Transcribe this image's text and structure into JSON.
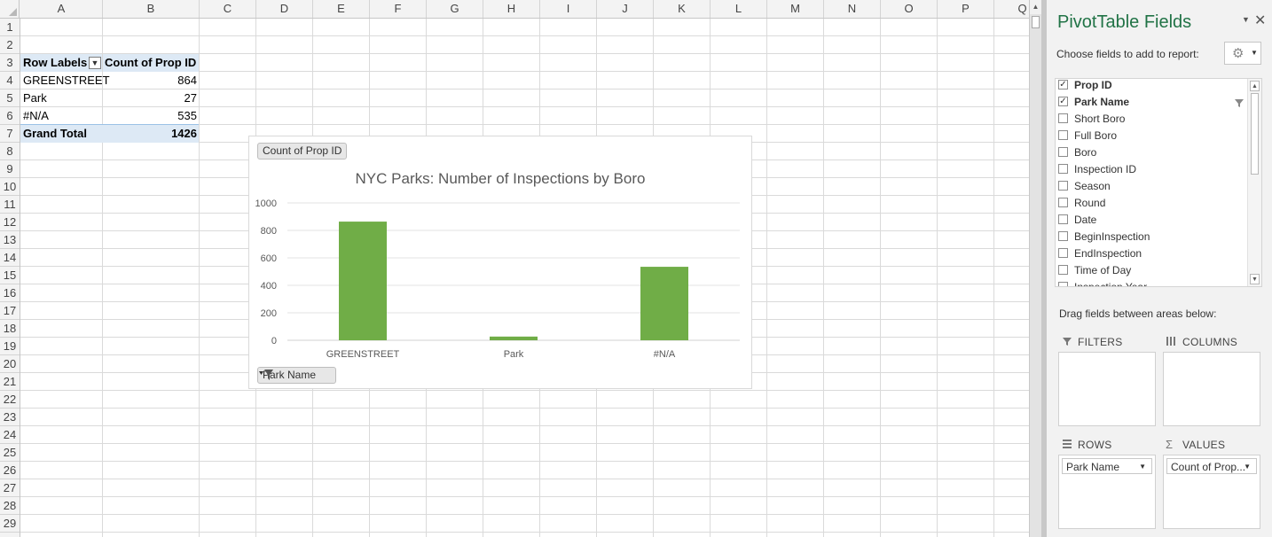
{
  "sheet": {
    "columns": [
      "A",
      "B",
      "C",
      "D",
      "E",
      "F",
      "G",
      "H",
      "I",
      "J",
      "K",
      "L",
      "M",
      "N",
      "O",
      "P",
      "Q"
    ],
    "rows": [
      "1",
      "2",
      "3",
      "4",
      "5",
      "6",
      "7",
      "8",
      "9",
      "10",
      "11",
      "12",
      "13",
      "14",
      "15",
      "16",
      "17",
      "18",
      "19",
      "20",
      "21",
      "22",
      "23",
      "24",
      "25",
      "26",
      "27",
      "28",
      "29"
    ]
  },
  "pivot_table": {
    "row_labels_header": "Row Labels",
    "value_header": "Count of Prop ID",
    "rows": [
      {
        "label": "GREENSTREET",
        "value": "864"
      },
      {
        "label": "Park",
        "value": "27"
      },
      {
        "label": "#N/A",
        "value": "535"
      }
    ],
    "total_label": "Grand Total",
    "total_value": "1426"
  },
  "chart": {
    "value_field_button": "Count of Prop ID",
    "axis_field_button": "Park Name",
    "title": "NYC Parks: Number of Inspections by Boro",
    "bar_color": "#70ad47"
  },
  "chart_data": {
    "type": "bar",
    "title": "NYC Parks: Number of Inspections by Boro",
    "categories": [
      "GREENSTREET",
      "Park",
      "#N/A"
    ],
    "values": [
      864,
      27,
      535
    ],
    "xlabel": "",
    "ylabel": "",
    "ylim": [
      0,
      1000
    ],
    "yticks": [
      "0",
      "200",
      "400",
      "600",
      "800",
      "1000"
    ],
    "grid": true,
    "legend": "none"
  },
  "pane": {
    "title": "PivotTable Fields",
    "choose_label": "Choose fields to add to report:",
    "fields": [
      {
        "label": "Prop ID",
        "checked": true,
        "filtered": false
      },
      {
        "label": "Park Name",
        "checked": true,
        "filtered": true
      },
      {
        "label": "Short Boro",
        "checked": false,
        "filtered": false
      },
      {
        "label": "Full Boro",
        "checked": false,
        "filtered": false
      },
      {
        "label": "Boro",
        "checked": false,
        "filtered": false
      },
      {
        "label": "Inspection ID",
        "checked": false,
        "filtered": false
      },
      {
        "label": "Season",
        "checked": false,
        "filtered": false
      },
      {
        "label": "Round",
        "checked": false,
        "filtered": false
      },
      {
        "label": "Date",
        "checked": false,
        "filtered": false
      },
      {
        "label": "BeginInspection",
        "checked": false,
        "filtered": false
      },
      {
        "label": "EndInspection",
        "checked": false,
        "filtered": false
      },
      {
        "label": "Time of Day",
        "checked": false,
        "filtered": false
      },
      {
        "label": "Inspection Year",
        "checked": false,
        "filtered": false
      }
    ],
    "drag_label": "Drag fields between areas below:",
    "areas": {
      "filters": "FILTERS",
      "columns": "COLUMNS",
      "rows": "ROWS",
      "values": "VALUES",
      "rows_item": "Park Name",
      "values_item": "Count of Prop..."
    }
  },
  "icons": {
    "close": "close-icon",
    "dropdown": "chevron-down-icon",
    "gear": "gear-icon",
    "filter": "filter-icon"
  }
}
